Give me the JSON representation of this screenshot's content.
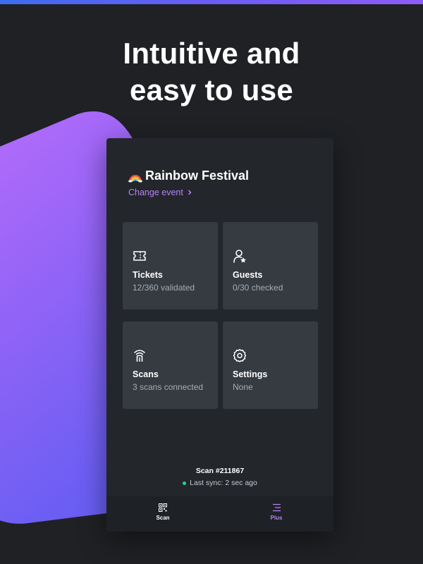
{
  "headline": {
    "line1": "Intuitive and",
    "line2": "easy to use"
  },
  "event": {
    "icon": "rainbow-icon",
    "title": "Rainbow Festival",
    "change_label": "Change event"
  },
  "cards": [
    {
      "icon": "ticket-icon",
      "title": "Tickets",
      "subtitle": "12/360 validated"
    },
    {
      "icon": "guest-star-icon",
      "title": "Guests",
      "subtitle": "0/30 checked"
    },
    {
      "icon": "scanner-signal-icon",
      "title": "Scans",
      "subtitle": "3 scans connected"
    },
    {
      "icon": "gear-icon",
      "title": "Settings",
      "subtitle": "None"
    }
  ],
  "status": {
    "scan_id": "Scan #211867",
    "sync_text": "Last sync: 2 sec ago"
  },
  "nav": {
    "scan_label": "Scan",
    "plus_label": "Plus"
  },
  "colors": {
    "accent": "#b583f7",
    "sync_dot": "#28d38c",
    "background": "#1f2124",
    "card": "#363a41"
  }
}
